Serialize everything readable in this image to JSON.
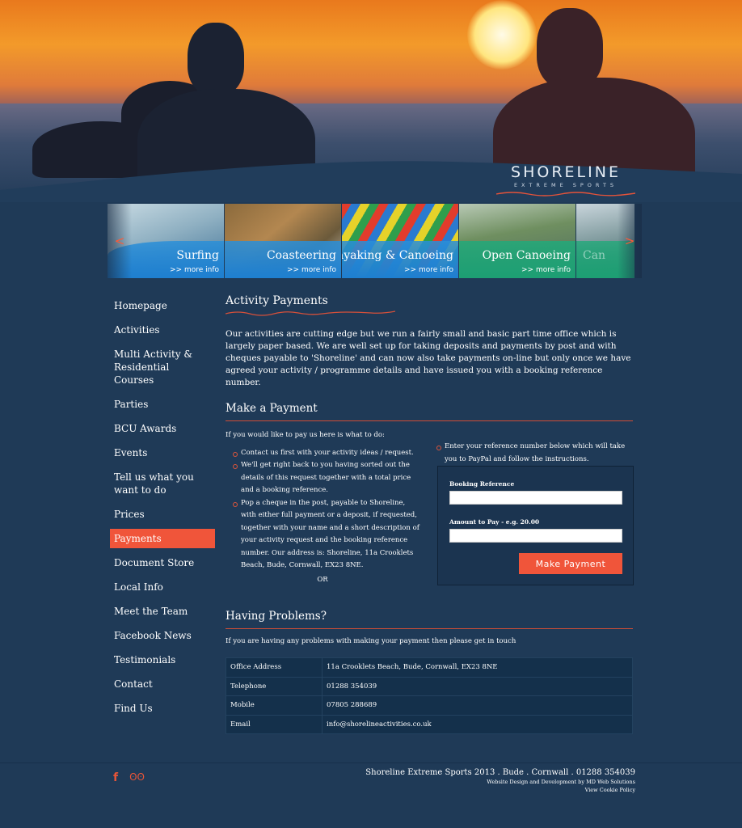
{
  "brand": {
    "name": "SHORELINE",
    "tagline": "EXTREME SPORTS"
  },
  "carousel": {
    "prev_icon": "<",
    "next_icon": ">",
    "slides": [
      {
        "title": "Surfing",
        "more": ">> more info",
        "band_color": "#2a8fd8"
      },
      {
        "title": "Coasteering",
        "more": ">> more info",
        "band_color": "#2a8fd8"
      },
      {
        "title": "Kayaking & Canoeing",
        "more": ">> more info",
        "band_color": "#2a8fd8"
      },
      {
        "title": "Open Canoeing",
        "more": ">> more info",
        "band_color": "#22a97a"
      },
      {
        "title": "Can",
        "more": "",
        "band_color": "#22a97a"
      }
    ]
  },
  "sidebar": {
    "items": [
      {
        "label": "Homepage"
      },
      {
        "label": "Activities"
      },
      {
        "label": "Multi Activity & Residential Courses"
      },
      {
        "label": "Parties"
      },
      {
        "label": "BCU Awards"
      },
      {
        "label": "Events"
      },
      {
        "label": "Tell us what you want to do"
      },
      {
        "label": "Prices"
      },
      {
        "label": "Payments",
        "active": true
      },
      {
        "label": "Document Store"
      },
      {
        "label": "Local Info"
      },
      {
        "label": "Meet the Team"
      },
      {
        "label": "Facebook News"
      },
      {
        "label": "Testimonials"
      },
      {
        "label": "Contact"
      },
      {
        "label": "Find Us"
      }
    ]
  },
  "main": {
    "title": "Activity Payments",
    "intro": "Our activities are cutting edge but we run a fairly small and basic part time office which is largely paper based. We are well set up for taking deposits and payments by post and with cheques payable to 'Shoreline' and can now also take payments on-line but only once we have agreed your activity / programme details and have issued you with a booking reference number.",
    "make_payment_heading": "Make a Payment",
    "left_intro": "If you would like to pay us here is what to do:",
    "steps": [
      "Contact us first with your activity ideas / request.",
      "We'll get right back to you having sorted out the details of this request together with a total price and a booking reference.",
      "Pop a cheque in the post, payable to Shoreline, with either full payment or a deposit, if requested, together with your name and a short description of your activity request and the booking reference number. Our address is: Shoreline, 11a Crooklets Beach, Bude, Cornwall, EX23 8NE."
    ],
    "or": "OR",
    "right_text": "Enter your reference number below which will take you to PayPal and follow the instructions.",
    "form": {
      "ref_label": "Booking Reference",
      "ref_value": "",
      "amount_label": "Amount to Pay - e.g. 20.00",
      "amount_value": "",
      "button": "Make Payment"
    },
    "problems_heading": "Having Problems?",
    "problems_text": "If you are having any problems with making your payment then please get in touch",
    "contact_rows": [
      {
        "key": "Office Address",
        "value": "11a Crooklets Beach, Bude, Cornwall, EX23 8NE"
      },
      {
        "key": "Telephone",
        "value": "01288 354039"
      },
      {
        "key": "Mobile",
        "value": "07805 288689"
      },
      {
        "key": "Email",
        "value": "info@shorelineactivities.co.uk"
      }
    ]
  },
  "footer": {
    "facebook_icon": "f",
    "tripadvisor_icon": "ʘʘ",
    "line1": "Shoreline Extreme Sports 2013 . Bude . Cornwall . 01288 354039",
    "line2": "Website Design and Development by MD Web Solutions",
    "line3": "View Cookie Policy"
  },
  "colors": {
    "accent": "#f0553a",
    "background": "#1f3a57"
  }
}
